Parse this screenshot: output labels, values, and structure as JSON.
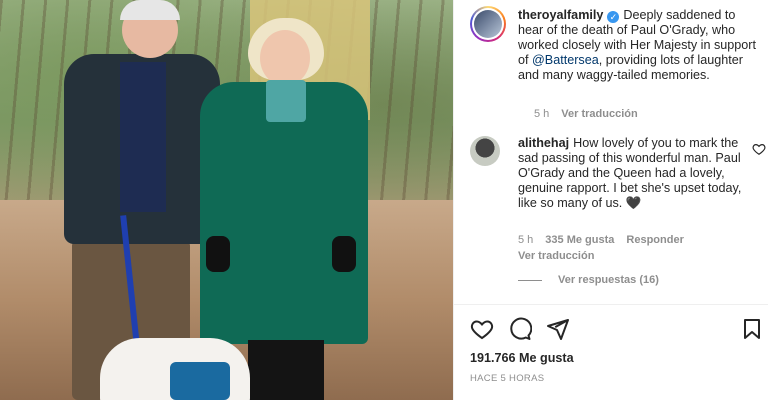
{
  "post": {
    "username": "theroyalfamily",
    "caption_before_mention": "Deeply saddened to hear of the death of Paul O'Grady, who worked closely with Her Majesty in support of",
    "mention": "@Battersea",
    "caption_after_mention": ", providing lots of laughter and many waggy-tailed memories.",
    "time_ago": "5 h",
    "see_translation": "Ver traducción"
  },
  "comment": {
    "username": "alithehaj",
    "text": "How lovely of you to mark the sad passing of this wonderful man. Paul O'Grady and the Queen had a lovely, genuine rapport. I bet she's upset today, like so many of us.",
    "emoji": "🖤",
    "time_ago": "5 h",
    "likes": "335 Me gusta",
    "reply": "Responder",
    "see_translation": "Ver traducción",
    "view_replies": "Ver respuestas (16)"
  },
  "footer": {
    "likes": "191.766 Me gusta",
    "timestamp": "HACE 5 HORAS"
  },
  "icons": [
    "heart-icon",
    "comment-icon",
    "share-icon",
    "bookmark-icon",
    "verified-badge-icon"
  ],
  "colors": {
    "link": "#00376b",
    "verified": "#3897f0",
    "muted": "#8e8e8e"
  }
}
